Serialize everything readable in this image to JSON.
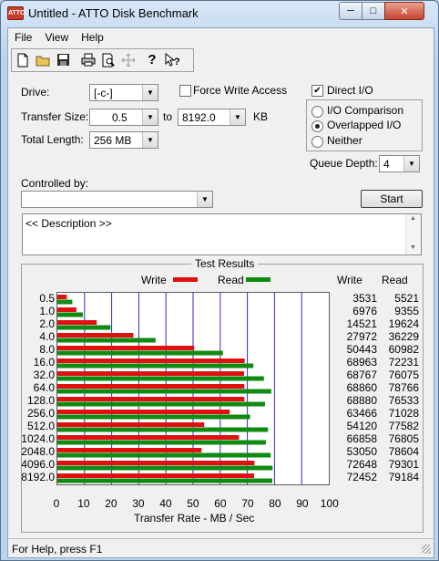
{
  "window": {
    "title": "Untitled - ATTO Disk Benchmark",
    "min_glyph": "─",
    "max_glyph": "□",
    "close_glyph": "✕"
  },
  "menu": [
    "File",
    "View",
    "Help"
  ],
  "toolbar": [
    "new-file-icon",
    "open-folder-icon",
    "save-icon",
    "print-icon",
    "print-preview-icon",
    "move-icon",
    "help-icon",
    "context-help-icon"
  ],
  "form": {
    "drive_label": "Drive:",
    "drive_value": "[-c-]",
    "force_write_label": "Force Write Access",
    "direct_io_label": "Direct I/O",
    "direct_io_checked": true,
    "transfer_size_label": "Transfer Size:",
    "transfer_from": "0.5",
    "to_label": "to",
    "transfer_to": "8192.0",
    "kb_label": "KB",
    "total_length_label": "Total Length:",
    "total_length_value": "256 MB",
    "radio_io_comparison": "I/O Comparison",
    "radio_overlapped": "Overlapped I/O",
    "radio_neither": "Neither",
    "queue_depth_label": "Queue Depth:",
    "queue_depth_value": "4",
    "controlled_by_label": "Controlled by:",
    "controlled_by_value": "",
    "start_label": "Start",
    "description": "<< Description >>"
  },
  "results": {
    "title": "Test Results",
    "write_col": "Write",
    "read_col": "Read"
  },
  "chart_data": {
    "type": "bar",
    "title": "Test Results",
    "xlabel": "Transfer Rate - MB / Sec",
    "xlim": [
      0,
      100
    ],
    "xticks": [
      "0",
      "10",
      "20",
      "30",
      "40",
      "50",
      "60",
      "70",
      "80",
      "90",
      "100"
    ],
    "categories": [
      "0.5",
      "1.0",
      "2.0",
      "4.0",
      "8.0",
      "16.0",
      "32.0",
      "64.0",
      "128.0",
      "256.0",
      "512.0",
      "1024.0",
      "2048.0",
      "4096.0",
      "8192.0"
    ],
    "series": [
      {
        "name": "Write",
        "color": "#e01010",
        "values": [
          3.5,
          7.0,
          14.5,
          28.0,
          50.4,
          69.0,
          68.8,
          68.9,
          68.9,
          63.5,
          54.1,
          66.9,
          53.1,
          72.6,
          72.5
        ]
      },
      {
        "name": "Read",
        "color": "#118a11",
        "values": [
          5.5,
          9.4,
          19.6,
          36.2,
          61.0,
          72.2,
          76.1,
          78.8,
          76.5,
          71.0,
          77.6,
          76.8,
          78.6,
          79.3,
          79.2
        ]
      }
    ],
    "table_write": [
      "3531",
      "6976",
      "14521",
      "27972",
      "50443",
      "68963",
      "68767",
      "68860",
      "68880",
      "63466",
      "54120",
      "66858",
      "53050",
      "72648",
      "72452"
    ],
    "table_read": [
      "5521",
      "9355",
      "19624",
      "36229",
      "60982",
      "72231",
      "76075",
      "78766",
      "76533",
      "71028",
      "77582",
      "76805",
      "78604",
      "79301",
      "79184"
    ],
    "grid": true,
    "legend": "top"
  },
  "status": "For Help, press F1"
}
